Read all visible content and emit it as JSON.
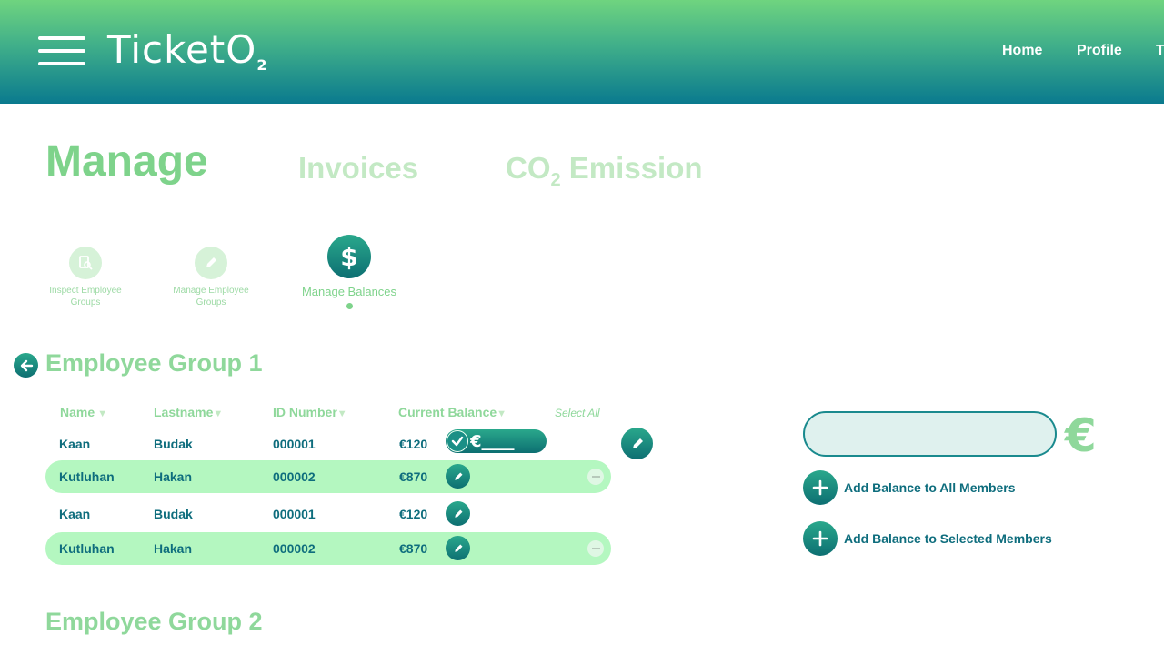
{
  "header": {
    "logo_text": "TicketO",
    "logo_sub": "2",
    "nav": {
      "home": "Home",
      "profile": "Profile",
      "cut": "T"
    }
  },
  "tabs": {
    "manage": "Manage",
    "invoices": "Invoices",
    "co2_prefix": "CO",
    "co2_sub": "2",
    "co2_suffix": " Emission"
  },
  "subnav": {
    "inspect": "Inspect Employee Groups",
    "manage_groups": "Manage Employee Groups",
    "balances": "Manage Balances"
  },
  "group1": {
    "title": "Employee Group 1",
    "headers": {
      "name": "Name",
      "lastname": "Lastname",
      "id": "ID Number",
      "balance": "Current Balance",
      "select_all": "Select All"
    },
    "rows": [
      {
        "name": "Kaan",
        "lastname": "Budak",
        "id": "000001",
        "balance": "€120",
        "editing": true,
        "edit_value": "€____"
      },
      {
        "name": "Kutluhan",
        "lastname": "Hakan",
        "id": "000002",
        "balance": "€870",
        "selected": true
      },
      {
        "name": "Kaan",
        "lastname": "Budak",
        "id": "000001",
        "balance": "€120"
      },
      {
        "name": "Kutluhan",
        "lastname": "Hakan",
        "id": "000002",
        "balance": "€870",
        "selected": true
      }
    ]
  },
  "group2": {
    "title": "Employee Group 2"
  },
  "balance_panel": {
    "amount_value": "",
    "currency": "€",
    "add_all": "Add Balance to All Members",
    "add_selected": "Add Balance to Selected Members"
  },
  "colors": {
    "header_top": "#6fd47f",
    "header_bottom": "#0a7a8e",
    "accent_green": "#7ed38b",
    "teal_text": "#0e6d7d",
    "row_highlight": "#b4f7c0"
  },
  "icons": [
    "menu-icon",
    "receipt-search-icon",
    "pencil-icon",
    "dollar-icon",
    "arrow-left-icon",
    "check-icon",
    "minus-icon",
    "plus-icon"
  ]
}
